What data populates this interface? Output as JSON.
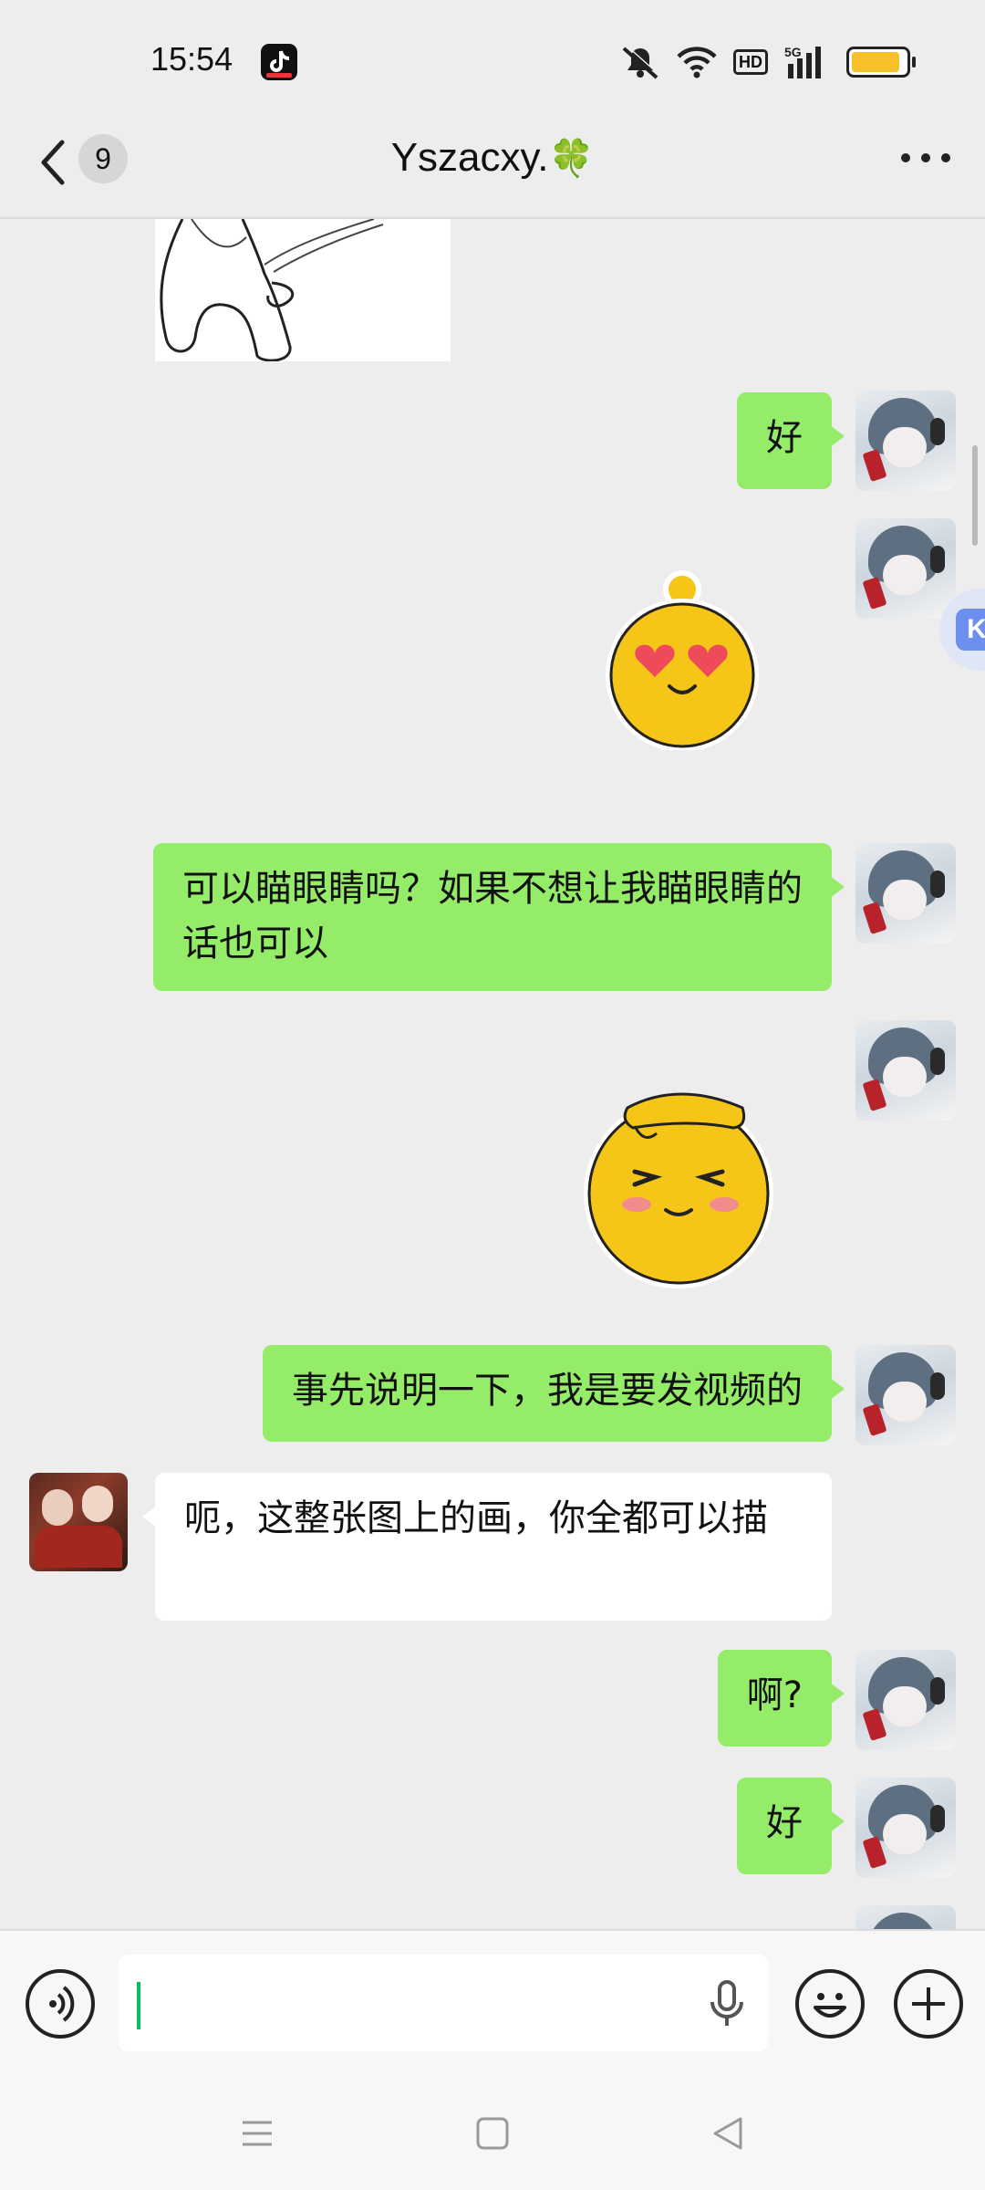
{
  "status_bar": {
    "time": "15:54",
    "hd_badge": "HD",
    "network": "5G",
    "battery_level": 0.9,
    "battery_color": "#f7c02b",
    "icons": [
      "tiktok-icon",
      "mute-icon",
      "wifi-icon",
      "hd-icon",
      "signal-5g-icon",
      "battery-icon"
    ]
  },
  "header": {
    "unread_count": "9",
    "title": "Yszacxy.",
    "title_emoji": "🍀"
  },
  "messages": [
    {
      "side": "other",
      "type": "image",
      "description_icon": "sketch-image"
    },
    {
      "side": "me",
      "type": "text",
      "text": "好"
    },
    {
      "side": "me",
      "type": "sticker",
      "icon": "heart-eyes-sticker"
    },
    {
      "side": "me",
      "type": "text",
      "text": "可以瞄眼睛吗？如果不想让我瞄眼睛的话也可以"
    },
    {
      "side": "me",
      "type": "sticker",
      "icon": "shy-blush-sticker"
    },
    {
      "side": "me",
      "type": "text",
      "text": "事先说明一下，我是要发视频的"
    },
    {
      "side": "other",
      "type": "text",
      "text": "呃，这整张图上的画，你全都可以描"
    },
    {
      "side": "me",
      "type": "text",
      "text": "啊?"
    },
    {
      "side": "me",
      "type": "text",
      "text": "好"
    }
  ],
  "input_bar": {
    "value": "",
    "icons": [
      "voice-mode-icon",
      "microphone-icon",
      "emoji-icon",
      "plus-icon"
    ]
  },
  "side_tab": {
    "label": "K"
  },
  "colors": {
    "background": "#ededed",
    "my_bubble": "#95ec69",
    "other_bubble": "#ffffff",
    "caret": "#07c160"
  }
}
